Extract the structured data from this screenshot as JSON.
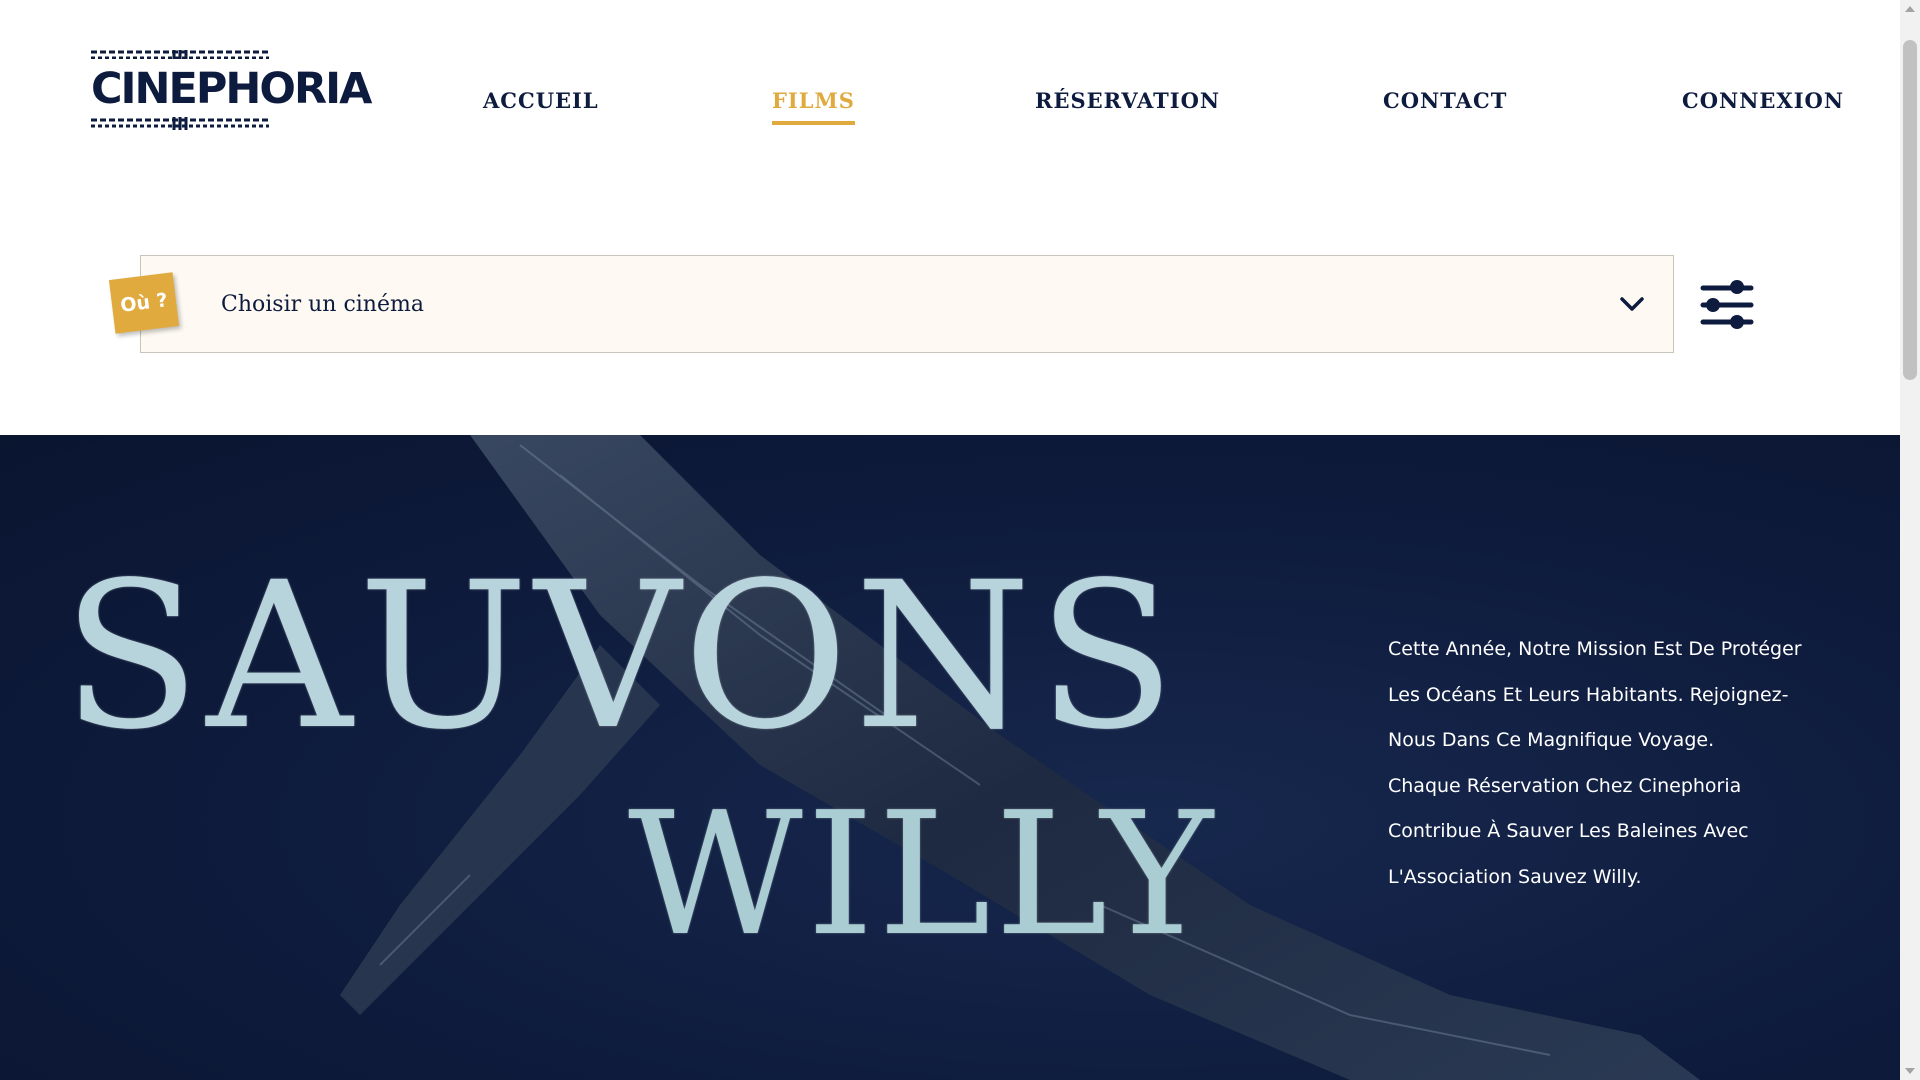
{
  "header": {
    "logo_text": "CINEPHORIA",
    "nav": [
      {
        "label": "ACCUEIL",
        "active": false
      },
      {
        "label": "FILMS",
        "active": true
      },
      {
        "label": "RÉSERVATION",
        "active": false
      },
      {
        "label": "CONTACT",
        "active": false
      },
      {
        "label": "CONNEXION",
        "active": false
      }
    ]
  },
  "selector": {
    "badge": "Où ?",
    "placeholder": "Choisir un cinéma"
  },
  "hero": {
    "title_line1": "SAUVONS",
    "title_line2": "WILLY",
    "paragraph1": "Cette Année, Notre Mission Est De Protéger Les Océans Et Leurs Habitants. Rejoignez-Nous Dans Ce Magnifique Voyage.",
    "paragraph2": "Chaque Réservation Chez Cinephoria Contribue À Sauver Les Baleines Avec L'Association Sauvez Willy."
  },
  "colors": {
    "navy": "#0d1b3e",
    "accent": "#e0aa3e",
    "selector_bg": "#fefaf3",
    "hero_bg": "#0e1b3c"
  },
  "icons": {
    "dropdown": "chevron-down-icon",
    "filters": "sliders-icon"
  }
}
